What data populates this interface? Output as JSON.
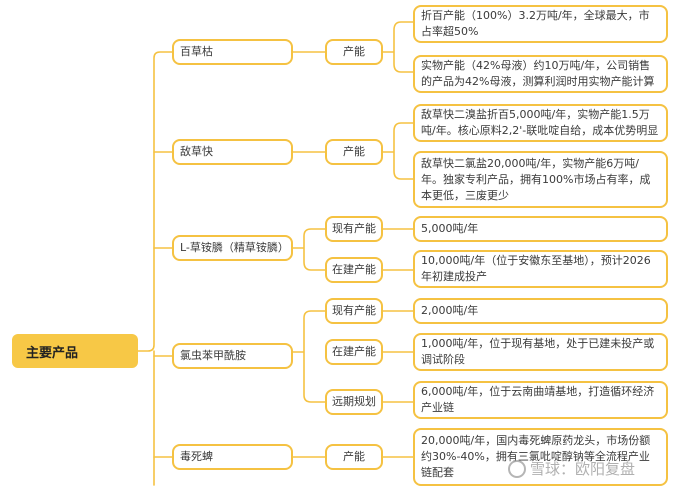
{
  "root": {
    "label": "主要产品"
  },
  "products": [
    {
      "name": "百草枯",
      "categories": [
        {
          "label": "产能",
          "details": [
            "折百产能（100%）3.2万吨/年，全球最大，市占率超50%",
            "实物产能（42%母液）约10万吨/年，公司销售的产品为42%母液，测算利润时用实物产能计算"
          ]
        }
      ]
    },
    {
      "name": "敌草快",
      "categories": [
        {
          "label": "产能",
          "details": [
            "敌草快二溴盐折百5,000吨/年，实物产能1.5万吨/年。核心原料2,2'-联吡啶自给，成本优势明显",
            "敌草快二氯盐20,000吨/年，实物产能6万吨/年。独家专利产品，拥有100%市场占有率，成本更低，三废更少"
          ]
        }
      ]
    },
    {
      "name": "L-草铵膦（精草铵膦）",
      "categories": [
        {
          "label": "现有产能",
          "details": [
            "5,000吨/年"
          ]
        },
        {
          "label": "在建产能",
          "details": [
            "10,000吨/年（位于安徽东至基地），预计2026年初建成投产"
          ]
        }
      ]
    },
    {
      "name": "氯虫苯甲酰胺",
      "categories": [
        {
          "label": "现有产能",
          "details": [
            "2,000吨/年"
          ]
        },
        {
          "label": "在建产能",
          "details": [
            "1,000吨/年，位于现有基地，处于已建未投产或调试阶段"
          ]
        },
        {
          "label": "远期规划",
          "details": [
            "6,000吨/年，位于云南曲靖基地，打造循环经济产业链"
          ]
        }
      ]
    },
    {
      "name": "毒死蜱",
      "categories": [
        {
          "label": "产能",
          "details": [
            "20,000吨/年，国内毒死蜱原药龙头，市场份额约30%-40%，拥有三氯吡啶醇钠等全流程产业链配套"
          ]
        }
      ]
    }
  ],
  "watermark": {
    "text": "雪球：欧阳复盘"
  },
  "colors": {
    "accent": "#f5c242",
    "root_fill": "#f7c846",
    "line": "#f5c242"
  }
}
